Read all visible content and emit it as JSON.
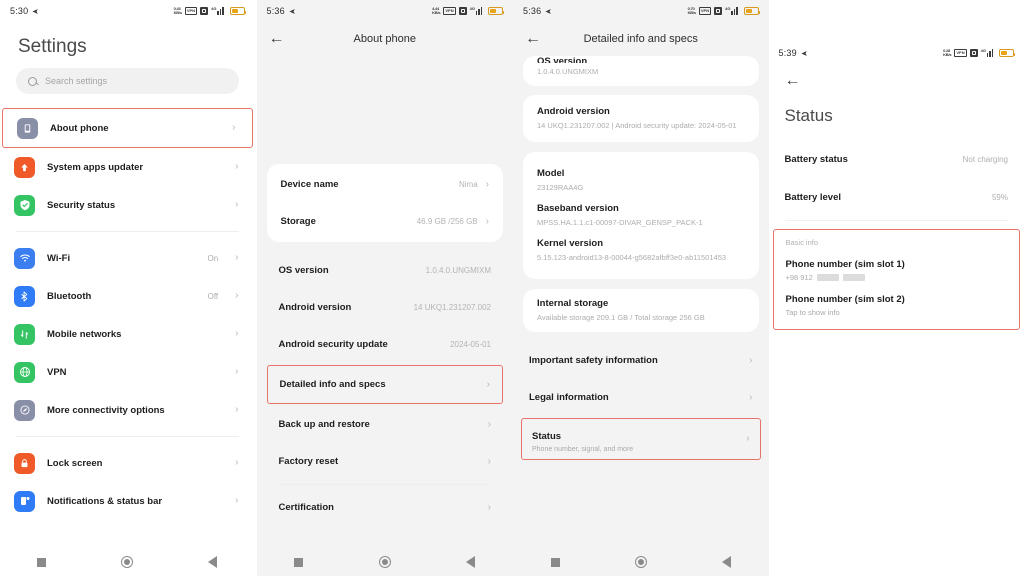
{
  "panels": {
    "settings": {
      "statusbar": {
        "clock": "5:30",
        "alarm_icon": "alarm-icon",
        "rate_top": "0.43",
        "rate_bottom": "KB/s",
        "vpn": "VPN",
        "network": "4G"
      },
      "title": "Settings",
      "search": {
        "placeholder": "Search settings",
        "icon": "search-icon"
      },
      "items": [
        {
          "label": "About phone",
          "icon": "phone-icon",
          "color": "#8a8fa8",
          "value": "",
          "highlighted": true
        },
        {
          "label": "System apps updater",
          "icon": "arrow-up-icon",
          "color": "#f05a28",
          "value": ""
        },
        {
          "label": "Security status",
          "icon": "shield-check-icon",
          "color": "#35c463",
          "value": ""
        },
        {
          "label": "Wi-Fi",
          "icon": "wifi-icon",
          "color": "#3b7ef0",
          "value": "On"
        },
        {
          "label": "Bluetooth",
          "icon": "bluetooth-icon",
          "color": "#2f7cf6",
          "value": "Off"
        },
        {
          "label": "Mobile networks",
          "icon": "mobile-networks-icon",
          "color": "#35c463",
          "value": ""
        },
        {
          "label": "VPN",
          "icon": "globe-icon",
          "color": "#35c463",
          "value": ""
        },
        {
          "label": "More connectivity options",
          "icon": "connectivity-icon",
          "color": "#8a8fa8",
          "value": ""
        },
        {
          "label": "Lock screen",
          "icon": "lock-icon",
          "color": "#f05a28",
          "value": ""
        },
        {
          "label": "Notifications & status bar",
          "icon": "notification-icon",
          "color": "#2f7cf6",
          "value": ""
        }
      ],
      "navbar": {
        "recent": "square-icon",
        "home": "circle-icon",
        "back": "triangle-back-icon"
      }
    },
    "about_phone": {
      "statusbar": {
        "clock": "5:36",
        "alarm_icon": "alarm-icon",
        "rate_top": "4.44",
        "rate_bottom": "KB/s",
        "vpn": "VPN",
        "network": "4G"
      },
      "title": "About phone",
      "back_icon": "back-arrow-icon",
      "card_rows": [
        {
          "label": "Device name",
          "value": "Nima"
        },
        {
          "label": "Storage",
          "value": "46.9 GB /256 GB"
        }
      ],
      "list_rows": [
        {
          "label": "OS version",
          "value": "1.0.4.0.UNGMIXM",
          "highlighted": false
        },
        {
          "label": "Android version",
          "value": "14 UKQ1.231207.002",
          "highlighted": false
        },
        {
          "label": "Android security update",
          "value": "2024-05-01",
          "highlighted": false
        },
        {
          "label": "Detailed info and specs",
          "value": "",
          "highlighted": true
        },
        {
          "label": "Back up and restore",
          "value": "",
          "highlighted": false
        },
        {
          "label": "Factory reset",
          "value": "",
          "highlighted": false
        },
        {
          "label": "Certification",
          "value": "",
          "highlighted": false
        }
      ]
    },
    "detailed_info": {
      "statusbar": {
        "clock": "5:36",
        "alarm_icon": "alarm-icon",
        "rate_top": "0.70",
        "rate_bottom": "KB/s",
        "vpn": "VPN",
        "network": "4G"
      },
      "title": "Detailed info and specs",
      "back_icon": "back-arrow-icon",
      "clipped_card": {
        "title": "OS version",
        "value": "1.0.4.0.UNGMIXM"
      },
      "android_card": {
        "title": "Android version",
        "value": "14 UKQ1.231207.002 | Android security update: 2024-05-01"
      },
      "specs_card": [
        {
          "title": "Model",
          "value": "23129RAA4G"
        },
        {
          "title": "Baseband version",
          "value": "MPSS.HA.1.1.c1-00097-DIVAR_GENSP_PACK-1"
        },
        {
          "title": "Kernel version",
          "value": "5.15.123-android13-8-00044-g5682afbff3e0-ab11501453"
        }
      ],
      "storage_card": {
        "title": "Internal storage",
        "value": "Available storage  209.1 GB / Total storage  256 GB"
      },
      "links": [
        {
          "label": "Important safety information",
          "sub": "",
          "highlighted": false
        },
        {
          "label": "Legal information",
          "sub": "",
          "highlighted": false
        },
        {
          "label": "Status",
          "sub": "Phone number, signal, and more",
          "highlighted": true
        }
      ]
    },
    "status": {
      "statusbar": {
        "clock": "5:39",
        "alarm_icon": "alarm-icon",
        "rate_top": "0.28",
        "rate_bottom": "KB/s",
        "vpn": "VPN",
        "network": "4G"
      },
      "title": "Status",
      "back_icon": "back-arrow-icon",
      "rows": [
        {
          "label": "Battery status",
          "value": "Not charging"
        },
        {
          "label": "Battery level",
          "value": "59%"
        }
      ],
      "basic_info": {
        "caption": "Basic info",
        "entries": [
          {
            "title": "Phone number (sim slot 1)",
            "sub": "+98 912",
            "redacted": true
          },
          {
            "title": "Phone number (sim slot 2)",
            "sub": "Tap to show info",
            "redacted": false
          }
        ]
      }
    }
  },
  "theme": {
    "highlight": "#e8736a",
    "accent_text": "#1d1d1d",
    "muted_text": "#adadad"
  }
}
